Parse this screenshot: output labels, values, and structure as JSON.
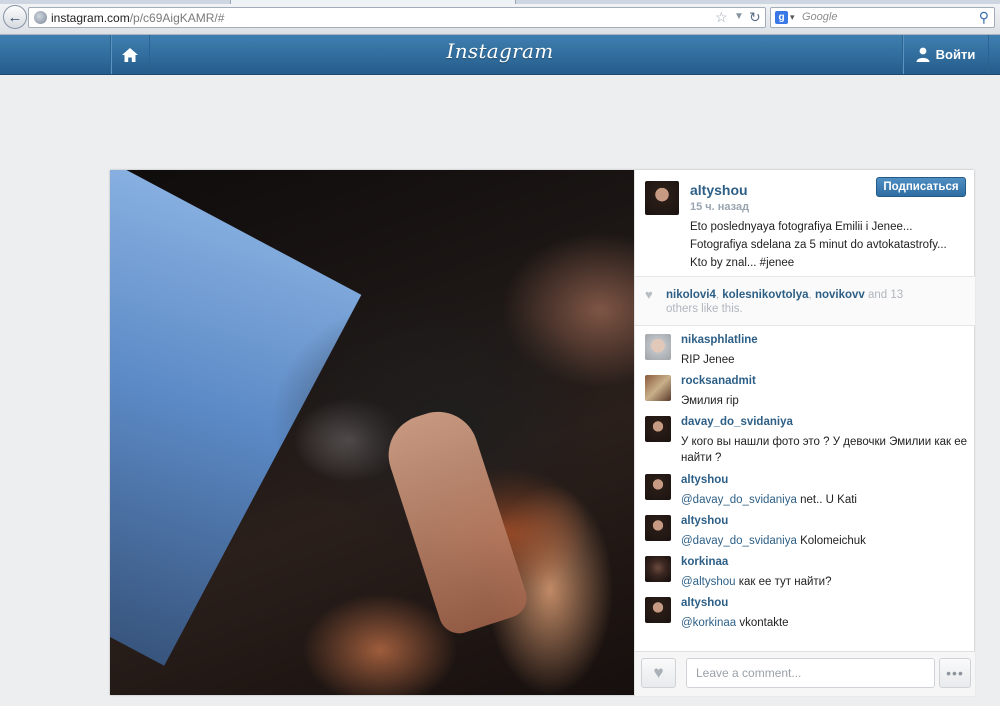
{
  "browser": {
    "url_host": "instagram.com",
    "url_path": "/p/c69AigKAMR/#",
    "search_engine_letter": "g",
    "search_placeholder": "Google"
  },
  "header": {
    "logo": "Instagram",
    "login_label": "Войти"
  },
  "post": {
    "owner": {
      "username": "altyshou",
      "time": "15 ч. назад",
      "caption": "Eto poslednyaya fotografiya Emilii i Jenee... Fotografiya sdelana za 5 minut do avtokatastrofy... Kto by znal... #jenee"
    },
    "follow_label": "Подписаться",
    "likes": {
      "users": [
        "nikolovi4",
        "kolesnikovtolya",
        "novikovv"
      ],
      "sep1": ", ",
      "sep2": ", ",
      "and_text": " and 13",
      "others_text": "others like this."
    },
    "comments": [
      {
        "user": "nikasphlatline",
        "mention": "",
        "text": "RIP Jenee"
      },
      {
        "user": "rocksanadmit",
        "mention": "",
        "text": "Эмилия rip"
      },
      {
        "user": "davay_do_svidaniya",
        "mention": "",
        "text": "У кого вы нашли фото это ? У девочки Эмилии как ее найти ?"
      },
      {
        "user": "altyshou",
        "mention": "@davay_do_svidaniya",
        "text": " net.. U Kati"
      },
      {
        "user": "altyshou",
        "mention": "@davay_do_svidaniya",
        "text": " Kolomeichuk"
      },
      {
        "user": "korkinaa",
        "mention": "@altyshou",
        "text": " как ее тут найти?"
      },
      {
        "user": "altyshou",
        "mention": "@korkinaa",
        "text": " vkontakte"
      }
    ],
    "composer": {
      "placeholder": "Leave a comment...",
      "more_label": "•••"
    }
  },
  "colors": {
    "header_blue": "#2f6b9c",
    "link_blue": "#2d5f86",
    "follow_button": "#3a7cb3"
  }
}
